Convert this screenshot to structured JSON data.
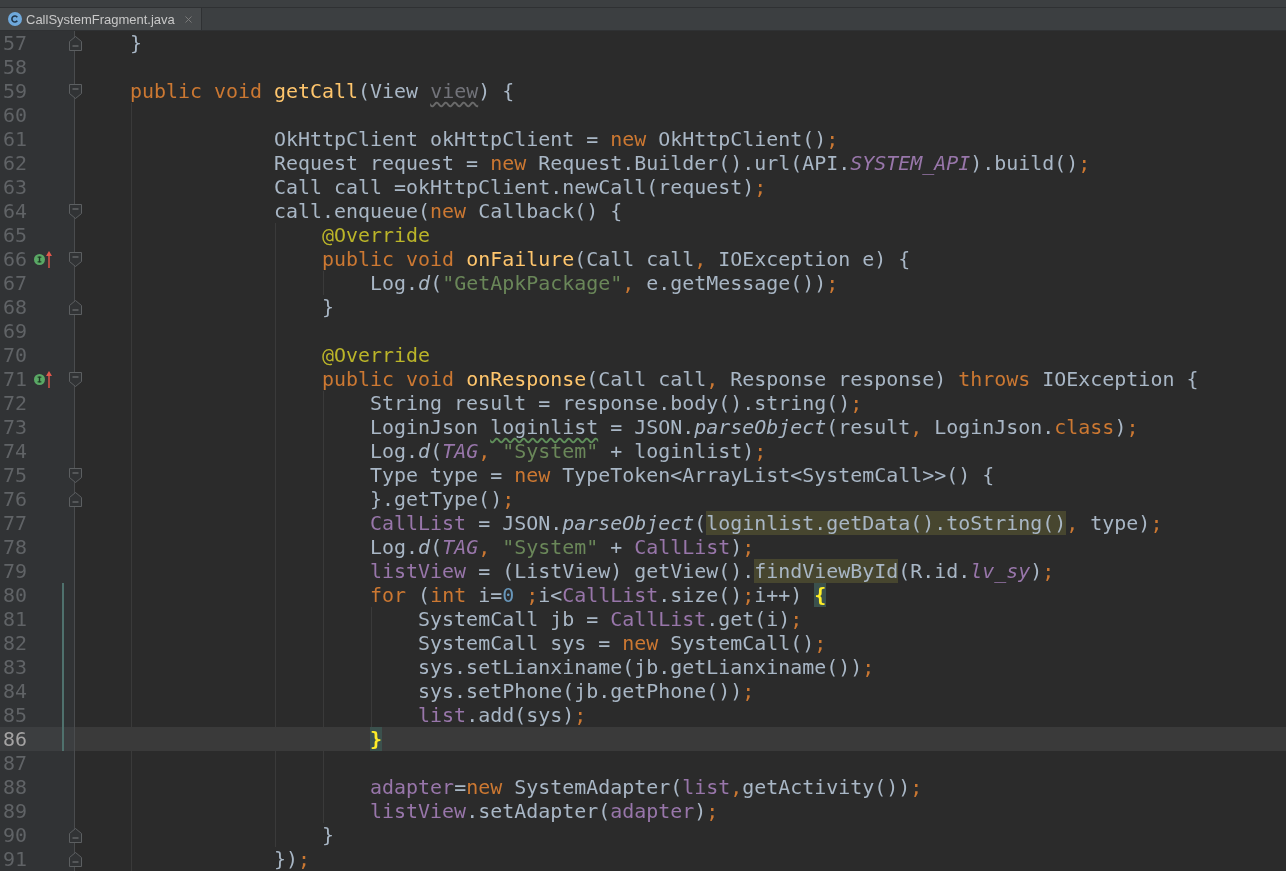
{
  "tab_bar": {
    "tabs": [
      {
        "label": "CallSystemFragment.java",
        "selected": true
      }
    ]
  },
  "editor": {
    "lines": [
      {
        "number": "57",
        "gutter": [
          {
            "kind": "fold_end"
          }
        ],
        "changed": false,
        "current": false,
        "tokens": [
          {
            "text": "    }",
            "kind": "plain"
          }
        ]
      },
      {
        "number": "58",
        "changed": false,
        "current": false
      },
      {
        "number": "59",
        "gutter": [
          {
            "kind": "fold_start"
          }
        ],
        "changed": false,
        "current": false,
        "tokens": [
          {
            "text": "    public void ",
            "kind": "kw"
          },
          {
            "text": "getCall",
            "kind": "fn"
          },
          {
            "text": "(View ",
            "kind": "plain"
          },
          {
            "text": "view",
            "kind": "unused"
          },
          {
            "text": ") {",
            "kind": "plain"
          }
        ]
      },
      {
        "number": "60",
        "changed": false,
        "current": false
      },
      {
        "number": "61",
        "changed": false,
        "current": false,
        "tokens": [
          {
            "text": "                OkHttpClient okHttpClient = ",
            "kind": "plain"
          },
          {
            "text": "new",
            "kind": "kw"
          },
          {
            "text": " OkHttpClient()",
            "kind": "plain"
          },
          {
            "text": ";",
            "kind": "kw"
          }
        ]
      },
      {
        "number": "62",
        "changed": false,
        "current": false,
        "tokens": [
          {
            "text": "                Request request = ",
            "kind": "plain"
          },
          {
            "text": "new",
            "kind": "kw"
          },
          {
            "text": " Request.Builder().url(API.",
            "kind": "plain"
          },
          {
            "text": "SYSTEM_API",
            "kind": "sfield"
          },
          {
            "text": ").build()",
            "kind": "plain"
          },
          {
            "text": ";",
            "kind": "kw"
          }
        ]
      },
      {
        "number": "63",
        "changed": false,
        "current": false,
        "tokens": [
          {
            "text": "                Call call =okHttpClient.newCall(request)",
            "kind": "plain"
          },
          {
            "text": ";",
            "kind": "kw"
          }
        ]
      },
      {
        "number": "64",
        "gutter": [
          {
            "kind": "fold_start"
          }
        ],
        "changed": false,
        "current": false,
        "tokens": [
          {
            "text": "                call.enqueue(",
            "kind": "plain"
          },
          {
            "text": "new",
            "kind": "kw"
          },
          {
            "text": " Callback() {",
            "kind": "plain"
          }
        ]
      },
      {
        "number": "65",
        "changed": false,
        "current": false,
        "tokens": [
          {
            "text": "                    @Override",
            "kind": "ann"
          }
        ]
      },
      {
        "number": "66",
        "gutter": [
          {
            "kind": "implements"
          },
          {
            "kind": "fold_start"
          }
        ],
        "changed": false,
        "current": false,
        "tokens": [
          {
            "text": "                    public void ",
            "kind": "kw"
          },
          {
            "text": "onFailure",
            "kind": "fn"
          },
          {
            "text": "(Call call",
            "kind": "plain"
          },
          {
            "text": ", ",
            "kind": "kw"
          },
          {
            "text": "IOException e) {",
            "kind": "plain"
          }
        ]
      },
      {
        "number": "67",
        "changed": false,
        "current": false,
        "tokens": [
          {
            "text": "                        Log.",
            "kind": "plain"
          },
          {
            "text": "d",
            "kind": "static"
          },
          {
            "text": "(",
            "kind": "plain"
          },
          {
            "text": "\"GetApkPackage\"",
            "kind": "str"
          },
          {
            "text": ", ",
            "kind": "kw"
          },
          {
            "text": "e.getMessage())",
            "kind": "plain"
          },
          {
            "text": ";",
            "kind": "kw"
          }
        ]
      },
      {
        "number": "68",
        "gutter": [
          {
            "kind": "fold_end"
          }
        ],
        "changed": false,
        "current": false,
        "tokens": [
          {
            "text": "                    }",
            "kind": "plain"
          }
        ]
      },
      {
        "number": "69",
        "changed": false,
        "current": false
      },
      {
        "number": "70",
        "changed": false,
        "current": false,
        "tokens": [
          {
            "text": "                    @Override",
            "kind": "ann"
          }
        ]
      },
      {
        "number": "71",
        "gutter": [
          {
            "kind": "implements"
          },
          {
            "kind": "fold_start"
          }
        ],
        "changed": false,
        "current": false,
        "tokens": [
          {
            "text": "                    public void ",
            "kind": "kw"
          },
          {
            "text": "onResponse",
            "kind": "fn"
          },
          {
            "text": "(Call call",
            "kind": "plain"
          },
          {
            "text": ", ",
            "kind": "kw"
          },
          {
            "text": "Response response) ",
            "kind": "plain"
          },
          {
            "text": "throws",
            "kind": "kw"
          },
          {
            "text": " IOException {",
            "kind": "plain"
          }
        ]
      },
      {
        "number": "72",
        "changed": false,
        "current": false,
        "tokens": [
          {
            "text": "                        String result = response.body().string()",
            "kind": "plain"
          },
          {
            "text": ";",
            "kind": "kw"
          }
        ]
      },
      {
        "number": "73",
        "changed": false,
        "current": false,
        "tokens": [
          {
            "text": "                        LoginJson ",
            "kind": "plain"
          },
          {
            "text": "loginlist",
            "kind": "typo"
          },
          {
            "text": " = JSON.",
            "kind": "plain"
          },
          {
            "text": "parseObject",
            "kind": "static"
          },
          {
            "text": "(result",
            "kind": "plain"
          },
          {
            "text": ", ",
            "kind": "kw"
          },
          {
            "text": "LoginJson.",
            "kind": "plain"
          },
          {
            "text": "class",
            "kind": "kw"
          },
          {
            "text": ")",
            "kind": "plain"
          },
          {
            "text": ";",
            "kind": "kw"
          }
        ]
      },
      {
        "number": "74",
        "changed": false,
        "current": false,
        "tokens": [
          {
            "text": "                        Log.",
            "kind": "plain"
          },
          {
            "text": "d",
            "kind": "static"
          },
          {
            "text": "(",
            "kind": "plain"
          },
          {
            "text": "TAG",
            "kind": "sfield"
          },
          {
            "text": ", ",
            "kind": "kw"
          },
          {
            "text": "\"System\"",
            "kind": "str"
          },
          {
            "text": " + loginlist)",
            "kind": "plain"
          },
          {
            "text": ";",
            "kind": "kw"
          }
        ]
      },
      {
        "number": "75",
        "gutter": [
          {
            "kind": "fold_start"
          }
        ],
        "changed": false,
        "current": false,
        "tokens": [
          {
            "text": "                        Type type = ",
            "kind": "plain"
          },
          {
            "text": "new",
            "kind": "kw"
          },
          {
            "text": " TypeToken<ArrayList<SystemCall>>() {",
            "kind": "plain"
          }
        ]
      },
      {
        "number": "76",
        "gutter": [
          {
            "kind": "fold_end"
          }
        ],
        "changed": false,
        "current": false,
        "tokens": [
          {
            "text": "                        }.getType()",
            "kind": "plain"
          },
          {
            "text": ";",
            "kind": "kw"
          }
        ]
      },
      {
        "number": "77",
        "changed": false,
        "current": false,
        "tokens": [
          {
            "text": "                        CallList",
            "kind": "field"
          },
          {
            "text": " = JSON.",
            "kind": "plain"
          },
          {
            "text": "parseObject",
            "kind": "static"
          },
          {
            "text": "(",
            "kind": "plain"
          },
          {
            "text": "loginlist.getData().toString()",
            "kind": "hl"
          },
          {
            "text": ", ",
            "kind": "kw"
          },
          {
            "text": "type)",
            "kind": "plain"
          },
          {
            "text": ";",
            "kind": "kw"
          }
        ]
      },
      {
        "number": "78",
        "changed": false,
        "current": false,
        "tokens": [
          {
            "text": "                        Log.",
            "kind": "plain"
          },
          {
            "text": "d",
            "kind": "static"
          },
          {
            "text": "(",
            "kind": "plain"
          },
          {
            "text": "TAG",
            "kind": "sfield"
          },
          {
            "text": ", ",
            "kind": "kw"
          },
          {
            "text": "\"System\"",
            "kind": "str"
          },
          {
            "text": " + ",
            "kind": "plain"
          },
          {
            "text": "CallList",
            "kind": "field"
          },
          {
            "text": ")",
            "kind": "plain"
          },
          {
            "text": ";",
            "kind": "kw"
          }
        ]
      },
      {
        "number": "79",
        "changed": false,
        "current": false,
        "tokens": [
          {
            "text": "                        listView",
            "kind": "field"
          },
          {
            "text": " = (ListView) getView().",
            "kind": "plain"
          },
          {
            "text": "findViewById",
            "kind": "hl"
          },
          {
            "text": "(R.id.",
            "kind": "plain"
          },
          {
            "text": "lv_sy",
            "kind": "sfield"
          },
          {
            "text": ")",
            "kind": "plain"
          },
          {
            "text": ";",
            "kind": "kw"
          }
        ]
      },
      {
        "number": "80",
        "changed": true,
        "current": false,
        "tokens": [
          {
            "text": "                        for",
            "kind": "kw"
          },
          {
            "text": " (",
            "kind": "plain"
          },
          {
            "text": "int",
            "kind": "kw"
          },
          {
            "text": " i=",
            "kind": "plain"
          },
          {
            "text": "0 ",
            "kind": "num"
          },
          {
            "text": ";",
            "kind": "kw"
          },
          {
            "text": "i<",
            "kind": "plain"
          },
          {
            "text": "CallList",
            "kind": "field"
          },
          {
            "text": ".size()",
            "kind": "plain"
          },
          {
            "text": ";",
            "kind": "kw"
          },
          {
            "text": "i++) ",
            "kind": "plain"
          },
          {
            "text": "{",
            "kind": "brace"
          }
        ]
      },
      {
        "number": "81",
        "changed": true,
        "current": false,
        "tokens": [
          {
            "text": "                            SystemCall jb = ",
            "kind": "plain"
          },
          {
            "text": "CallList",
            "kind": "field"
          },
          {
            "text": ".get(i)",
            "kind": "plain"
          },
          {
            "text": ";",
            "kind": "kw"
          }
        ]
      },
      {
        "number": "82",
        "changed": true,
        "current": false,
        "tokens": [
          {
            "text": "                            SystemCall sys = ",
            "kind": "plain"
          },
          {
            "text": "new",
            "kind": "kw"
          },
          {
            "text": " SystemCall()",
            "kind": "plain"
          },
          {
            "text": ";",
            "kind": "kw"
          }
        ]
      },
      {
        "number": "83",
        "changed": true,
        "current": false,
        "tokens": [
          {
            "text": "                            sys.setLianxiname(jb.getLianxiname())",
            "kind": "plain"
          },
          {
            "text": ";",
            "kind": "kw"
          }
        ]
      },
      {
        "number": "84",
        "changed": true,
        "current": false,
        "tokens": [
          {
            "text": "                            sys.setPhone(jb.getPhone())",
            "kind": "plain"
          },
          {
            "text": ";",
            "kind": "kw"
          }
        ]
      },
      {
        "number": "85",
        "changed": true,
        "current": false,
        "tokens": [
          {
            "text": "                            list",
            "kind": "field"
          },
          {
            "text": ".add(sys)",
            "kind": "plain"
          },
          {
            "text": ";",
            "kind": "kw"
          }
        ]
      },
      {
        "number": "86",
        "changed": true,
        "current": true,
        "tokens": [
          {
            "text": "                        }",
            "kind": "brace"
          }
        ]
      },
      {
        "number": "87",
        "changed": false,
        "current": false
      },
      {
        "number": "88",
        "changed": false,
        "current": false,
        "tokens": [
          {
            "text": "                        adapter",
            "kind": "field"
          },
          {
            "text": "=",
            "kind": "plain"
          },
          {
            "text": "new",
            "kind": "kw"
          },
          {
            "text": " SystemAdapter(",
            "kind": "plain"
          },
          {
            "text": "list",
            "kind": "field"
          },
          {
            "text": ",",
            "kind": "kw"
          },
          {
            "text": "getActivity())",
            "kind": "plain"
          },
          {
            "text": ";",
            "kind": "kw"
          }
        ]
      },
      {
        "number": "89",
        "changed": false,
        "current": false,
        "tokens": [
          {
            "text": "                        listView",
            "kind": "field"
          },
          {
            "text": ".setAdapter(",
            "kind": "plain"
          },
          {
            "text": "adapter",
            "kind": "field"
          },
          {
            "text": ")",
            "kind": "plain"
          },
          {
            "text": ";",
            "kind": "kw"
          }
        ]
      },
      {
        "number": "90",
        "gutter": [
          {
            "kind": "fold_end"
          }
        ],
        "changed": false,
        "current": false,
        "tokens": [
          {
            "text": "                    }",
            "kind": "plain"
          }
        ]
      },
      {
        "number": "91",
        "gutter": [
          {
            "kind": "fold_end"
          }
        ],
        "changed": false,
        "current": false,
        "tokens": [
          {
            "text": "                })",
            "kind": "plain"
          },
          {
            "text": ";",
            "kind": "kw"
          }
        ]
      }
    ]
  }
}
